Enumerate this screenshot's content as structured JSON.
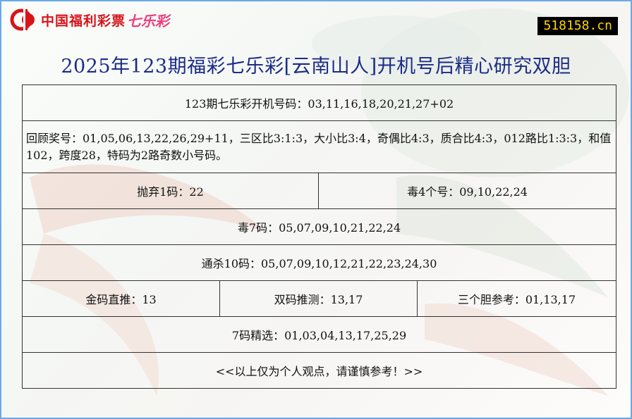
{
  "header": {
    "logo_text": "中国福利彩票",
    "logo_product": "七乐彩",
    "site_badge": "518158.cn"
  },
  "title": "2025年123期福彩七乐彩[云南山人]开机号后精心研究双胆",
  "rows": {
    "kaiji": "123期七乐彩开机号码：03,11,16,18,20,21,27+02",
    "review": "回顾奖号：01,05,06,13,22,26,29+11，三区比3:1:3，大小比3:4，奇偶比4:3，质合比4:3，012路比1:3:3，和值102，跨度28，特码为2路奇数小号码。",
    "discard": "抛弃1码：22",
    "poison4": "毒4个号：09,10,22,24",
    "poison7": "毒7码：05,07,09,10,21,22,24",
    "kill10": "通杀10码：05,07,09,10,12,21,22,23,24,30",
    "gold": "金码直推：13",
    "double": "双码推测：13,17",
    "three": "三个胆参考：01,13,17",
    "select7": "7码精选：01,03,04,13,17,25,29",
    "disclaimer": "<<以上仅为个人观点，请谨慎参考！>>"
  },
  "colors": {
    "frame_border": "#6aa9e6",
    "title": "#1b2c86",
    "logo_red": "#d7141a",
    "logo_pink": "#ee3d7c",
    "badge_bg": "#000000",
    "badge_text": "#ffd400"
  }
}
